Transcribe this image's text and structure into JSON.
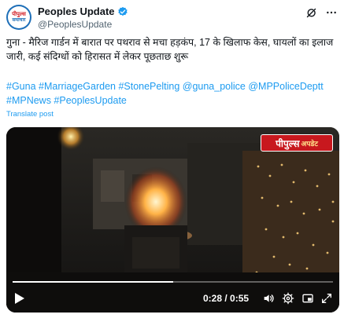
{
  "account": {
    "avatar_text_line1": "पीपुल्स",
    "avatar_text_line2": "समाचार",
    "display_name": "Peoples Update",
    "handle": "@PeoplesUpdate"
  },
  "top_icons": [
    "grok-icon",
    "more-icon"
  ],
  "post": {
    "text": "गुना - मैरिज गार्डन में बारात पर पथराव से मचा हड़कंप, 17 के खिलाफ केस, घायलों का इलाज जारी, कई संदिग्धों को हिरासत में लेकर पूछताछ शुरू",
    "hashtags": "#Guna #MarriageGarden #StonePelting @guna_police @MPPoliceDeptt #MPNews #PeoplesUpdate",
    "translate_label": "Translate post"
  },
  "video": {
    "badge_text": "पीपुल्स",
    "badge_tag": "अपडेट",
    "progress": 0.5,
    "time_display": "0:28 / 0:55"
  },
  "colors": {
    "link": "#1d9bf0",
    "verified": "#1d9bf0",
    "badge": "#c8181e"
  }
}
